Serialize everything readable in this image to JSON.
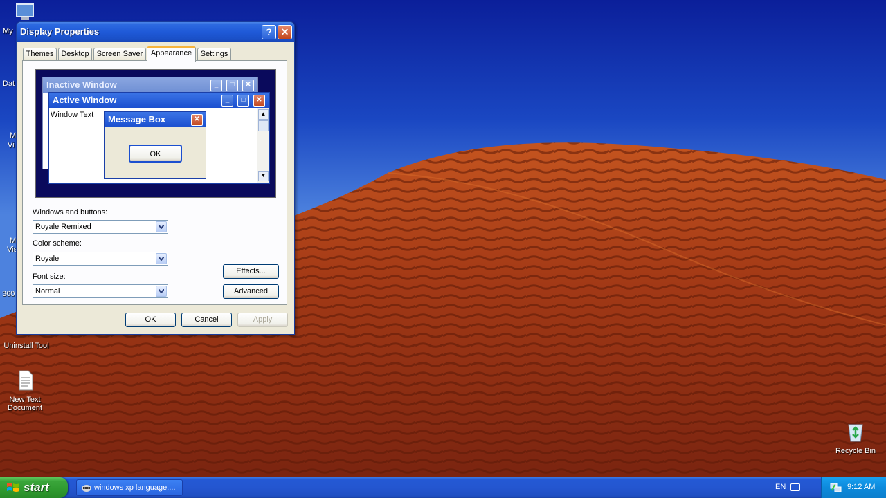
{
  "desktop": {
    "icons": {
      "uninstall_tool": "Uninstall Tool",
      "new_text_document": "New Text Document",
      "recycle_bin": "Recycle Bin"
    },
    "partial_labels": [
      "My",
      "Dat",
      "M",
      "Vi",
      "M",
      "Vis",
      "360"
    ]
  },
  "window": {
    "title": "Display Properties",
    "tabs": [
      "Themes",
      "Desktop",
      "Screen Saver",
      "Appearance",
      "Settings"
    ],
    "active_tab": "Appearance",
    "preview": {
      "inactive_window": "Inactive Window",
      "active_window": "Active Window",
      "window_text": "Window Text",
      "message_box": "Message Box",
      "ok": "OK"
    },
    "windows_and_buttons_label": "Windows and buttons:",
    "windows_and_buttons_value": "Royale Remixed",
    "color_scheme_label": "Color scheme:",
    "color_scheme_value": "Royale",
    "font_size_label": "Font size:",
    "font_size_value": "Normal",
    "effects_button": "Effects...",
    "advanced_button": "Advanced",
    "ok_button": "OK",
    "cancel_button": "Cancel",
    "apply_button": "Apply"
  },
  "taskbar": {
    "start_label": "start",
    "task_label": "windows xp language....",
    "language": "EN",
    "clock": "9:12 AM"
  },
  "colors": {
    "titlebar": "#1f5ad8",
    "taskbar": "#2456d0",
    "start": "#2f9a2f",
    "sand": "#a83c18"
  }
}
